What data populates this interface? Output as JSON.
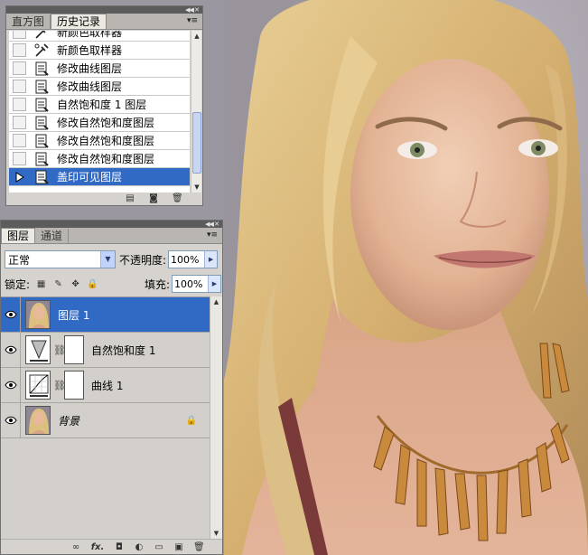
{
  "history_panel": {
    "tabs": [
      {
        "label": "直方图",
        "active": false
      },
      {
        "label": "历史记录",
        "active": true
      }
    ],
    "items": [
      {
        "label": "新颜色取样器",
        "icon": "color-sampler-icon",
        "selected": false
      },
      {
        "label": "新颜色取样器",
        "icon": "color-sampler-icon",
        "selected": false
      },
      {
        "label": "修改曲线图层",
        "icon": "history-state-icon",
        "selected": false
      },
      {
        "label": "修改曲线图层",
        "icon": "history-state-icon",
        "selected": false
      },
      {
        "label": "自然饱和度 1 图层",
        "icon": "history-state-icon",
        "selected": false
      },
      {
        "label": "修改自然饱和度图层",
        "icon": "history-state-icon",
        "selected": false
      },
      {
        "label": "修改自然饱和度图层",
        "icon": "history-state-icon",
        "selected": false
      },
      {
        "label": "修改自然饱和度图层",
        "icon": "history-state-icon",
        "selected": false
      },
      {
        "label": "盖印可见图层",
        "icon": "history-state-icon",
        "selected": true
      }
    ],
    "footer_icons": [
      "new-document-from-state-icon",
      "snapshot-camera-icon",
      "trash-icon"
    ]
  },
  "layers_panel": {
    "tabs": [
      {
        "label": "图层",
        "active": true
      },
      {
        "label": "通道",
        "active": false
      }
    ],
    "blend_mode": "正常",
    "opacity_label": "不透明度:",
    "opacity_value": "100%",
    "lock_label": "锁定:",
    "lock_icons": [
      "lock-transparent-pixels-icon",
      "lock-image-pixels-icon",
      "lock-position-icon",
      "lock-all-icon"
    ],
    "fill_label": "填充:",
    "fill_value": "100%",
    "layers": [
      {
        "name": "图层 1",
        "type": "pixel",
        "selected": true,
        "visible": true
      },
      {
        "name": "自然饱和度 1",
        "type": "vibrance-adjustment",
        "selected": false,
        "visible": true,
        "has_mask": true
      },
      {
        "name": "曲线 1",
        "type": "curves-adjustment",
        "selected": false,
        "visible": true,
        "has_mask": true
      },
      {
        "name": "背景",
        "type": "background",
        "selected": false,
        "visible": true,
        "locked": true
      }
    ],
    "footer_icons": [
      "link-layers-icon",
      "fx-icon",
      "add-mask-icon",
      "adjustment-layer-icon",
      "new-group-icon",
      "new-layer-icon",
      "trash-icon"
    ],
    "footer_fx_label": "fx."
  },
  "colors": {
    "selection": "#316ac5",
    "panel_bg": "#d6d3ce",
    "dark_bar": "#5c5c5c"
  }
}
